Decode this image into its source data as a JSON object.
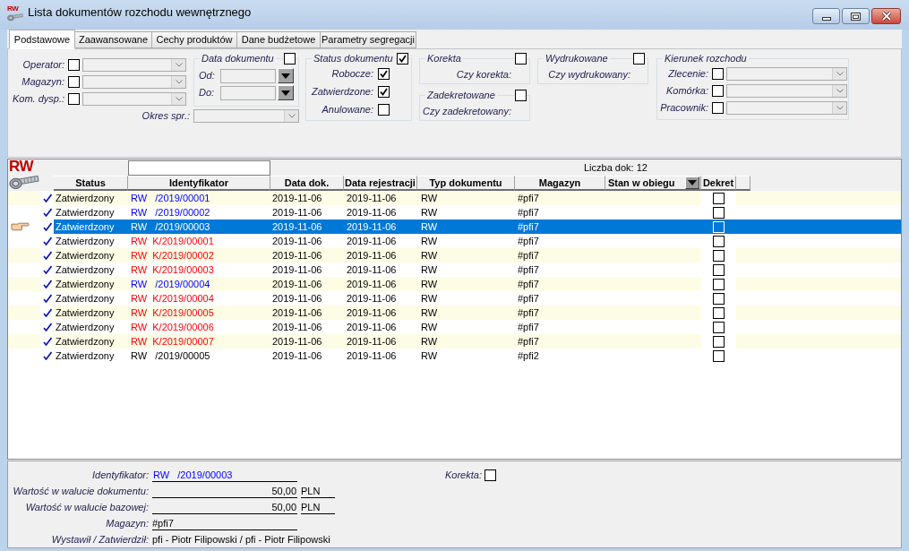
{
  "window": {
    "title": "Lista dokumentów rozchodu wewnętrznego",
    "icon_label": "RW"
  },
  "tabs": [
    {
      "label": "Podstawowe",
      "selected": true
    },
    {
      "label": "Zaawansowane",
      "selected": false
    },
    {
      "label": "Cechy produktów",
      "selected": false
    },
    {
      "label": "Dane budżetowe",
      "selected": false
    },
    {
      "label": "Parametry segregacji",
      "selected": false
    }
  ],
  "filters": {
    "left_fields": [
      {
        "label": "Operator:",
        "checked": false
      },
      {
        "label": "Magazyn:",
        "checked": false
      },
      {
        "label": "Kom. dysp.:",
        "checked": false
      }
    ],
    "document_date": {
      "title": "Data dokumentu",
      "checked": false,
      "fields": [
        {
          "label": "Od:"
        },
        {
          "label": "Do:"
        }
      ]
    },
    "period": {
      "label": "Okres spr.:"
    },
    "document_status": {
      "title": "Status dokumentu",
      "checked": true,
      "options": [
        {
          "label": "Robocze:",
          "checked": true
        },
        {
          "label": "Zatwierdzone:",
          "checked": true
        },
        {
          "label": "Anulowane:",
          "checked": false
        }
      ]
    },
    "correction": {
      "title": "Korekta",
      "checked": false,
      "label": "Czy korekta:"
    },
    "posted": {
      "title": "Zadekretowane",
      "checked": false,
      "label": "Czy zadekretowany:"
    },
    "printed": {
      "title": "Wydrukowane",
      "checked": false,
      "label": "Czy wydrukowany:"
    },
    "issue_direction": {
      "title": "Kierunek rozchodu",
      "fields": [
        {
          "label": "Zlecenie:",
          "checked": false
        },
        {
          "label": "Komórka:",
          "checked": false
        },
        {
          "label": "Pracownik:",
          "checked": false
        }
      ]
    }
  },
  "grid": {
    "logo_label": "RW",
    "count_label": "Liczba dok: 12",
    "columns": [
      {
        "label": "Status",
        "kind": "plain"
      },
      {
        "label": "Identyfikator",
        "kind": "plain"
      },
      {
        "label": "Data dok.",
        "kind": "plain"
      },
      {
        "label": "Data rejestracji",
        "kind": "plain"
      },
      {
        "label": "Typ dokumentu",
        "kind": "plain"
      },
      {
        "label": "Magazyn",
        "kind": "plain"
      },
      {
        "label": "Stan w obiegu",
        "kind": "dropdown"
      },
      {
        "label": "Dekret",
        "kind": "plain"
      }
    ],
    "rows": [
      {
        "status": "Zatwierdzony",
        "identifier": "RW   /2019/00001",
        "color": "#0000ff",
        "doc_date": "2019-11-06",
        "reg_date": "2019-11-06",
        "doc_type": "RW",
        "warehouse": "#pfi7",
        "posted": false,
        "selected": false
      },
      {
        "status": "Zatwierdzony",
        "identifier": "RW   /2019/00002",
        "color": "#0000ff",
        "doc_date": "2019-11-06",
        "reg_date": "2019-11-06",
        "doc_type": "RW",
        "warehouse": "#pfi7",
        "posted": false,
        "selected": false
      },
      {
        "status": "Zatwierdzony",
        "identifier": "RW   /2019/00003",
        "doc_date": "2019-11-06",
        "reg_date": "2019-11-06",
        "doc_type": "RW",
        "warehouse": "#pfi7",
        "posted": false,
        "selected": true
      },
      {
        "status": "Zatwierdzony",
        "identifier": "RW  K/2019/00001",
        "color": "#ff0000",
        "doc_date": "2019-11-06",
        "reg_date": "2019-11-06",
        "doc_type": "RW",
        "warehouse": "#pfi7",
        "posted": false,
        "selected": false
      },
      {
        "status": "Zatwierdzony",
        "identifier": "RW  K/2019/00002",
        "color": "#ff0000",
        "doc_date": "2019-11-06",
        "reg_date": "2019-11-06",
        "doc_type": "RW",
        "warehouse": "#pfi7",
        "posted": false,
        "selected": false
      },
      {
        "status": "Zatwierdzony",
        "identifier": "RW  K/2019/00003",
        "color": "#ff0000",
        "doc_date": "2019-11-06",
        "reg_date": "2019-11-06",
        "doc_type": "RW",
        "warehouse": "#pfi7",
        "posted": false,
        "selected": false
      },
      {
        "status": "Zatwierdzony",
        "identifier": "RW   /2019/00004",
        "color": "#0000ff",
        "doc_date": "2019-11-06",
        "reg_date": "2019-11-06",
        "doc_type": "RW",
        "warehouse": "#pfi7",
        "posted": false,
        "selected": false
      },
      {
        "status": "Zatwierdzony",
        "identifier": "RW  K/2019/00004",
        "color": "#ff0000",
        "doc_date": "2019-11-06",
        "reg_date": "2019-11-06",
        "doc_type": "RW",
        "warehouse": "#pfi7",
        "posted": false,
        "selected": false
      },
      {
        "status": "Zatwierdzony",
        "identifier": "RW  K/2019/00005",
        "color": "#ff0000",
        "doc_date": "2019-11-06",
        "reg_date": "2019-11-06",
        "doc_type": "RW",
        "warehouse": "#pfi7",
        "posted": false,
        "selected": false
      },
      {
        "status": "Zatwierdzony",
        "identifier": "RW  K/2019/00006",
        "color": "#ff0000",
        "doc_date": "2019-11-06",
        "reg_date": "2019-11-06",
        "doc_type": "RW",
        "warehouse": "#pfi7",
        "posted": false,
        "selected": false
      },
      {
        "status": "Zatwierdzony",
        "identifier": "RW  K/2019/00007",
        "color": "#ff0000",
        "doc_date": "2019-11-06",
        "reg_date": "2019-11-06",
        "doc_type": "RW",
        "warehouse": "#pfi7",
        "posted": false,
        "selected": false
      },
      {
        "status": "Zatwierdzony",
        "identifier": "RW   /2019/00005",
        "color": "#000000",
        "doc_date": "2019-11-06",
        "reg_date": "2019-11-06",
        "doc_type": "RW",
        "warehouse": "#pfi2",
        "posted": false,
        "selected": false
      }
    ]
  },
  "details": {
    "identifier": {
      "label": "Identyfikator:",
      "value": "RW   /2019/00003"
    },
    "correction": {
      "label": "Korekta:",
      "checked": false
    },
    "doc_value": {
      "label": "Wartość w walucie dokumentu:",
      "amount": "50,00",
      "currency": "PLN"
    },
    "base_value": {
      "label": "Wartość w walucie bazowej:",
      "amount": "50,00",
      "currency": "PLN"
    },
    "warehouse": {
      "label": "Magazyn:",
      "value": "#pfi7"
    },
    "issued_approved": {
      "label": "Wystawił / Zatwierdził:",
      "value": "pfi - Piotr Filipowski / pfi - Piotr Filipowski"
    }
  }
}
